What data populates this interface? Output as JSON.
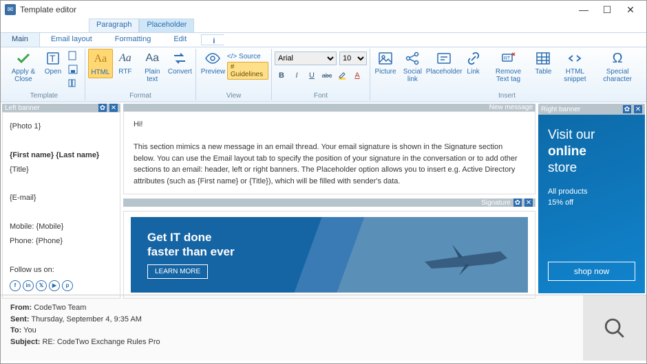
{
  "window": {
    "title": "Template editor"
  },
  "context_tabs": {
    "paragraph": "Paragraph",
    "placeholder": "Placeholder"
  },
  "tabs": {
    "main": "Main",
    "email_layout": "Email layout",
    "formatting": "Formatting",
    "edit": "Edit"
  },
  "ribbon": {
    "template": {
      "label": "Template",
      "apply_close": "Apply & Close",
      "open": "Open"
    },
    "format": {
      "label": "Format",
      "html": "HTML",
      "rtf": "RTF",
      "plain": "Plain text",
      "convert": "Convert"
    },
    "view": {
      "label": "View",
      "preview": "Preview",
      "source": "</> Source",
      "guidelines": "# Guidelines"
    },
    "font": {
      "label": "Font",
      "family": "Arial",
      "size": "10"
    },
    "insert": {
      "label": "Insert",
      "picture": "Picture",
      "social": "Social link",
      "placeholder": "Placeholder",
      "link": "Link",
      "remove_tag": "Remove Text tag",
      "table": "Table",
      "snippet": "HTML snippet",
      "special": "Special character"
    }
  },
  "left_banner": {
    "title": "Left banner",
    "photo": "{Photo 1}",
    "name": "{First name} {Last name}",
    "title_ph": "{Title}",
    "email": "{E-mail}",
    "mobile": "Mobile: {Mobile}",
    "phone": "Phone: {Phone}",
    "follow": "Follow us on:"
  },
  "new_message": {
    "title": "New message",
    "greeting": "Hi!",
    "body": "This section mimics a new message in an email thread. Your email signature is shown in the Signature section below. You can use the Email layout tab to specify the position of your signature in the conversation or to add other sections to an email: header, left or right banners. The Placeholder option allows you to insert e.g. Active Directory attributes (such as {First name} or {Title}), which will be filled with sender's data."
  },
  "signature": {
    "title": "Signature",
    "headline1": "Get IT done",
    "headline2": "faster than ever",
    "cta": "LEARN MORE"
  },
  "right_banner": {
    "title": "Right banner",
    "line1": "Visit our",
    "line2": "online",
    "line3": "store",
    "sub1": "All products",
    "sub2": "15% off",
    "cta": "shop now"
  },
  "mail": {
    "from_l": "From:",
    "from_v": " CodeTwo Team",
    "sent_l": "Sent:",
    "sent_v": " Thursday, September 4, 9:35 AM",
    "to_l": "To:",
    "to_v": " You",
    "subj_l": "Subject:",
    "subj_v": " RE: CodeTwo Exchange Rules Pro"
  }
}
